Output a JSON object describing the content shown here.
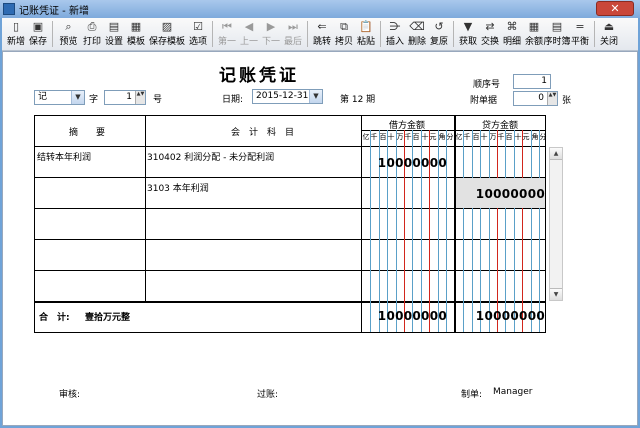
{
  "window": {
    "title": "记账凭证 - 新增",
    "close_glyph": "✕"
  },
  "toolbar": [
    {
      "label": "新增",
      "icon": "new-doc-icon",
      "glyph": "▯",
      "enabled": true
    },
    {
      "label": "保存",
      "icon": "save-icon",
      "glyph": "▣",
      "enabled": true
    },
    {
      "sep": true
    },
    {
      "label": "预览",
      "icon": "preview-icon",
      "glyph": "⌕",
      "enabled": true
    },
    {
      "label": "打印",
      "icon": "print-icon",
      "glyph": "⎙",
      "enabled": true
    },
    {
      "label": "设置",
      "icon": "settings-icon",
      "glyph": "▤",
      "enabled": true
    },
    {
      "label": "模板",
      "icon": "template-icon",
      "glyph": "▦",
      "enabled": true
    },
    {
      "label": "保存模板",
      "icon": "save-template-icon",
      "glyph": "▨",
      "enabled": true
    },
    {
      "label": "选项",
      "icon": "options-icon",
      "glyph": "☑",
      "enabled": true
    },
    {
      "sep": true
    },
    {
      "label": "第一",
      "icon": "first-icon",
      "glyph": "⏮",
      "enabled": false
    },
    {
      "label": "上一",
      "icon": "prev-icon",
      "glyph": "◀",
      "enabled": false
    },
    {
      "label": "下一",
      "icon": "next-icon",
      "glyph": "▶",
      "enabled": false
    },
    {
      "label": "最后",
      "icon": "last-icon",
      "glyph": "⏭",
      "enabled": false
    },
    {
      "sep": true
    },
    {
      "label": "跳转",
      "icon": "jump-icon",
      "glyph": "⇐",
      "enabled": true
    },
    {
      "label": "拷贝",
      "icon": "copy-icon",
      "glyph": "⧉",
      "enabled": true
    },
    {
      "label": "粘贴",
      "icon": "paste-icon",
      "glyph": "📋",
      "enabled": true
    },
    {
      "sep": true
    },
    {
      "label": "插入",
      "icon": "insert-icon",
      "glyph": "⋺",
      "enabled": true
    },
    {
      "label": "删除",
      "icon": "delete-icon",
      "glyph": "⌫",
      "enabled": true
    },
    {
      "label": "复原",
      "icon": "restore-icon",
      "glyph": "↺",
      "enabled": true
    },
    {
      "sep": true
    },
    {
      "label": "获取",
      "icon": "fetch-icon",
      "glyph": "▼",
      "enabled": true
    },
    {
      "label": "交换",
      "icon": "swap-icon",
      "glyph": "⇄",
      "enabled": true
    },
    {
      "label": "明细",
      "icon": "detail-icon",
      "glyph": "⌘",
      "enabled": true
    },
    {
      "label": "余额",
      "icon": "balance-icon",
      "glyph": "▦",
      "enabled": true
    },
    {
      "label": "序时簿",
      "icon": "journal-icon",
      "glyph": "▤",
      "enabled": true
    },
    {
      "label": "平衡",
      "icon": "equal-icon",
      "glyph": "=",
      "enabled": true
    },
    {
      "sep": true
    },
    {
      "label": "关闭",
      "icon": "close-door-icon",
      "glyph": "⏏",
      "enabled": true
    }
  ],
  "voucher": {
    "title": "记账凭证",
    "type_value": "记",
    "zi_label": "字",
    "number_value": "1",
    "hao_label": "号",
    "date_label": "日期:",
    "date_value": "2015-12-31",
    "period": "第 12 期",
    "seq_label": "顺序号",
    "seq_value": "1",
    "attach_label": "附单据",
    "attach_value": "0",
    "zhang_label": "张",
    "dropdown_glyph": "▼",
    "spin_glyph": "▲▼"
  },
  "grid": {
    "col_summary": "摘　　要",
    "col_account": "会　计　科　目",
    "col_debit": "借方金额",
    "col_credit": "贷方金额",
    "digit_labels": [
      "亿",
      "千",
      "百",
      "十",
      "万",
      "千",
      "百",
      "十",
      "元",
      "角",
      "分"
    ],
    "rows": [
      {
        "summary": "结转本年利润",
        "account": "310402 利润分配 - 未分配利润",
        "debit": "10000000",
        "credit": ""
      },
      {
        "summary": "",
        "account": "3103 本年利润",
        "debit": "",
        "credit": "10000000"
      },
      {
        "summary": "",
        "account": "",
        "debit": "",
        "credit": ""
      },
      {
        "summary": "",
        "account": "",
        "debit": "",
        "credit": ""
      },
      {
        "summary": "",
        "account": "",
        "debit": "",
        "credit": ""
      }
    ],
    "total_label": "合　计:",
    "total_words": "壹拾万元整",
    "total_debit": "10000000",
    "total_credit": "10000000"
  },
  "footer": {
    "review_label": "审核:",
    "post_label": "过账:",
    "maker_label": "制单:",
    "maker_value": "Manager"
  }
}
